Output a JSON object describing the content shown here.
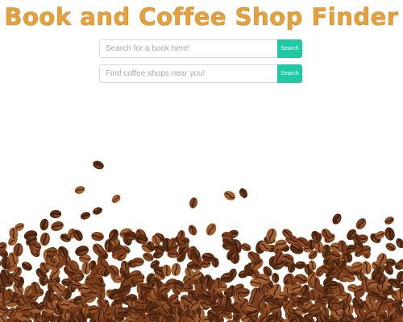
{
  "header": {
    "title": "Book and Coffee Shop Finder"
  },
  "book_search": {
    "placeholder": "Search for a book here!",
    "button_label": "Search"
  },
  "coffee_search": {
    "placeholder": "Find coffee shops near you!",
    "button_label": "Search"
  },
  "colors": {
    "title": "#e5a13c",
    "button": "#1fc9a4",
    "bean_dark": "#5a2c12",
    "bean_mid": "#7b3f1c",
    "bean_light": "#9a5a2c"
  },
  "background_image": {
    "icon": "coffee-beans-image"
  }
}
